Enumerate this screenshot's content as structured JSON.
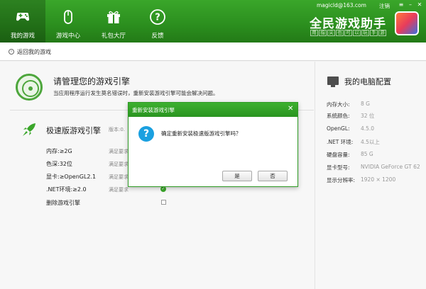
{
  "nav": [
    {
      "label": "我的游戏",
      "icon": "gamepad-icon"
    },
    {
      "label": "游戏中心",
      "icon": "mouse-icon"
    },
    {
      "label": "礼包大厅",
      "icon": "gift-icon"
    },
    {
      "label": "反馈",
      "icon": "help-icon"
    }
  ],
  "header": {
    "account": "magicld@163.com",
    "logout": "注销",
    "logo_title": "全民游戏助手",
    "logo_sub": [
      "用",
      "指",
      "尖",
      "也",
      "可",
      "以",
      "玩",
      "手",
      "游"
    ]
  },
  "back": {
    "label": "返回我的游戏"
  },
  "manage": {
    "title": "请管理您的游戏引擎",
    "desc": "当应用程序运行发生莫名错误时，重新安装游戏引擎可能会解决问题。"
  },
  "engine": {
    "title": "极速版游戏引擎",
    "version": "版本:0.",
    "requirements": [
      {
        "label": "内存:≥2G",
        "status": "满足要求"
      },
      {
        "label": "色深:32位",
        "status": "满足要求"
      },
      {
        "label": "显卡:≥OpenGL2.1",
        "status": "满足要求"
      },
      {
        "label": ".NET环境:≥2.0",
        "status": "满足要求"
      }
    ],
    "delete_label": "删除游戏引擎"
  },
  "pc": {
    "title": "我的电脑配置",
    "specs": [
      {
        "label": "内存大小:",
        "value": "8 G"
      },
      {
        "label": "系统颜色:",
        "value": "32 位"
      },
      {
        "label": "OpenGL:",
        "value": "4.5.0"
      },
      {
        "label": ".NET 环境:",
        "value": "4.5以上"
      },
      {
        "label": "硬盘容量:",
        "value": "85 G"
      },
      {
        "label": "显卡型号:",
        "value": "NVIDIA GeForce GT 62"
      },
      {
        "label": "显示分辨率:",
        "value": "1920 × 1200"
      }
    ]
  },
  "dialog": {
    "title": "重新安装游戏引擎",
    "message": "确定重新安装极速版游戏引擎吗？",
    "yes": "是",
    "no": "否"
  },
  "colors": {
    "brand_green": "#2b8e1e",
    "question_blue": "#1aa0e0"
  }
}
